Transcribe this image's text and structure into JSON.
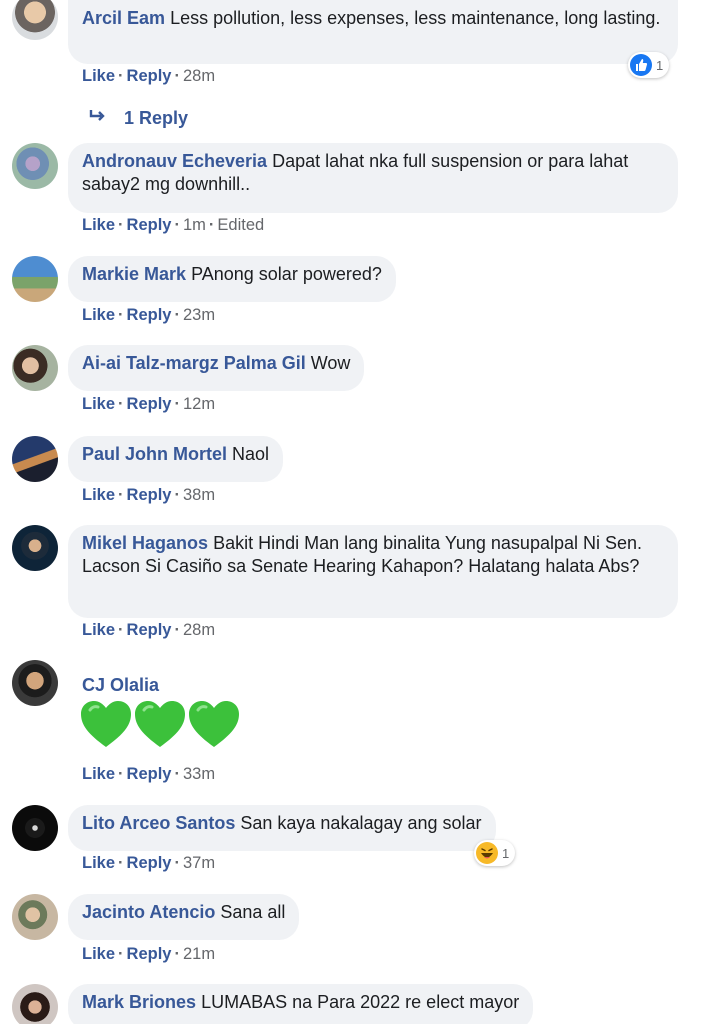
{
  "actions": {
    "like": "Like",
    "reply": "Reply",
    "sep": "·"
  },
  "comments": [
    {
      "author": "Arcil Eam",
      "text": "Less pollution, less expenses, less maintenance, long lasting.",
      "time": "28m",
      "reaction_count": "1",
      "reaction_icon": "like-reaction-icon",
      "replies_label": "1 Reply"
    },
    {
      "author": "Andronauv Echeveria",
      "text": "Dapat lahat nka full suspension or para lahat sabay2 mg downhill..",
      "time": "1m",
      "edited": "Edited"
    },
    {
      "author": "Markie Mark",
      "text": "PAnong solar powered?",
      "time": "23m"
    },
    {
      "author": "Ai-ai Talz-margz Palma Gil",
      "text": "Wow",
      "time": "12m"
    },
    {
      "author": "Paul John Mortel",
      "text": "Naol",
      "time": "38m"
    },
    {
      "author": "Mikel Haganos",
      "text": "Bakit Hindi Man lang binalita Yung nasupalpal Ni Sen. Lacson Si Casiño sa Senate Hearing Kahapon? Halatang halata Abs?",
      "time": "28m"
    },
    {
      "author": "CJ Olalia",
      "text": "",
      "time": "33m",
      "emoji": "green-heart-icon"
    },
    {
      "author": "Lito Arceo Santos",
      "text": "San kaya nakalagay ang solar",
      "time": "37m",
      "reaction_count": "1",
      "reaction_icon": "haha-reaction-icon"
    },
    {
      "author": "Jacinto Atencio",
      "text": "Sana all",
      "time": "21m"
    },
    {
      "author": "Mark Briones",
      "text": "LUMABAS na Para 2022 re elect mayor",
      "time": ""
    }
  ],
  "colors": {
    "link": "#385898",
    "bubble": "#f0f2f5",
    "meta": "#65676b",
    "like_blue": "#1877f2",
    "heart_green": "#3cc13b"
  }
}
